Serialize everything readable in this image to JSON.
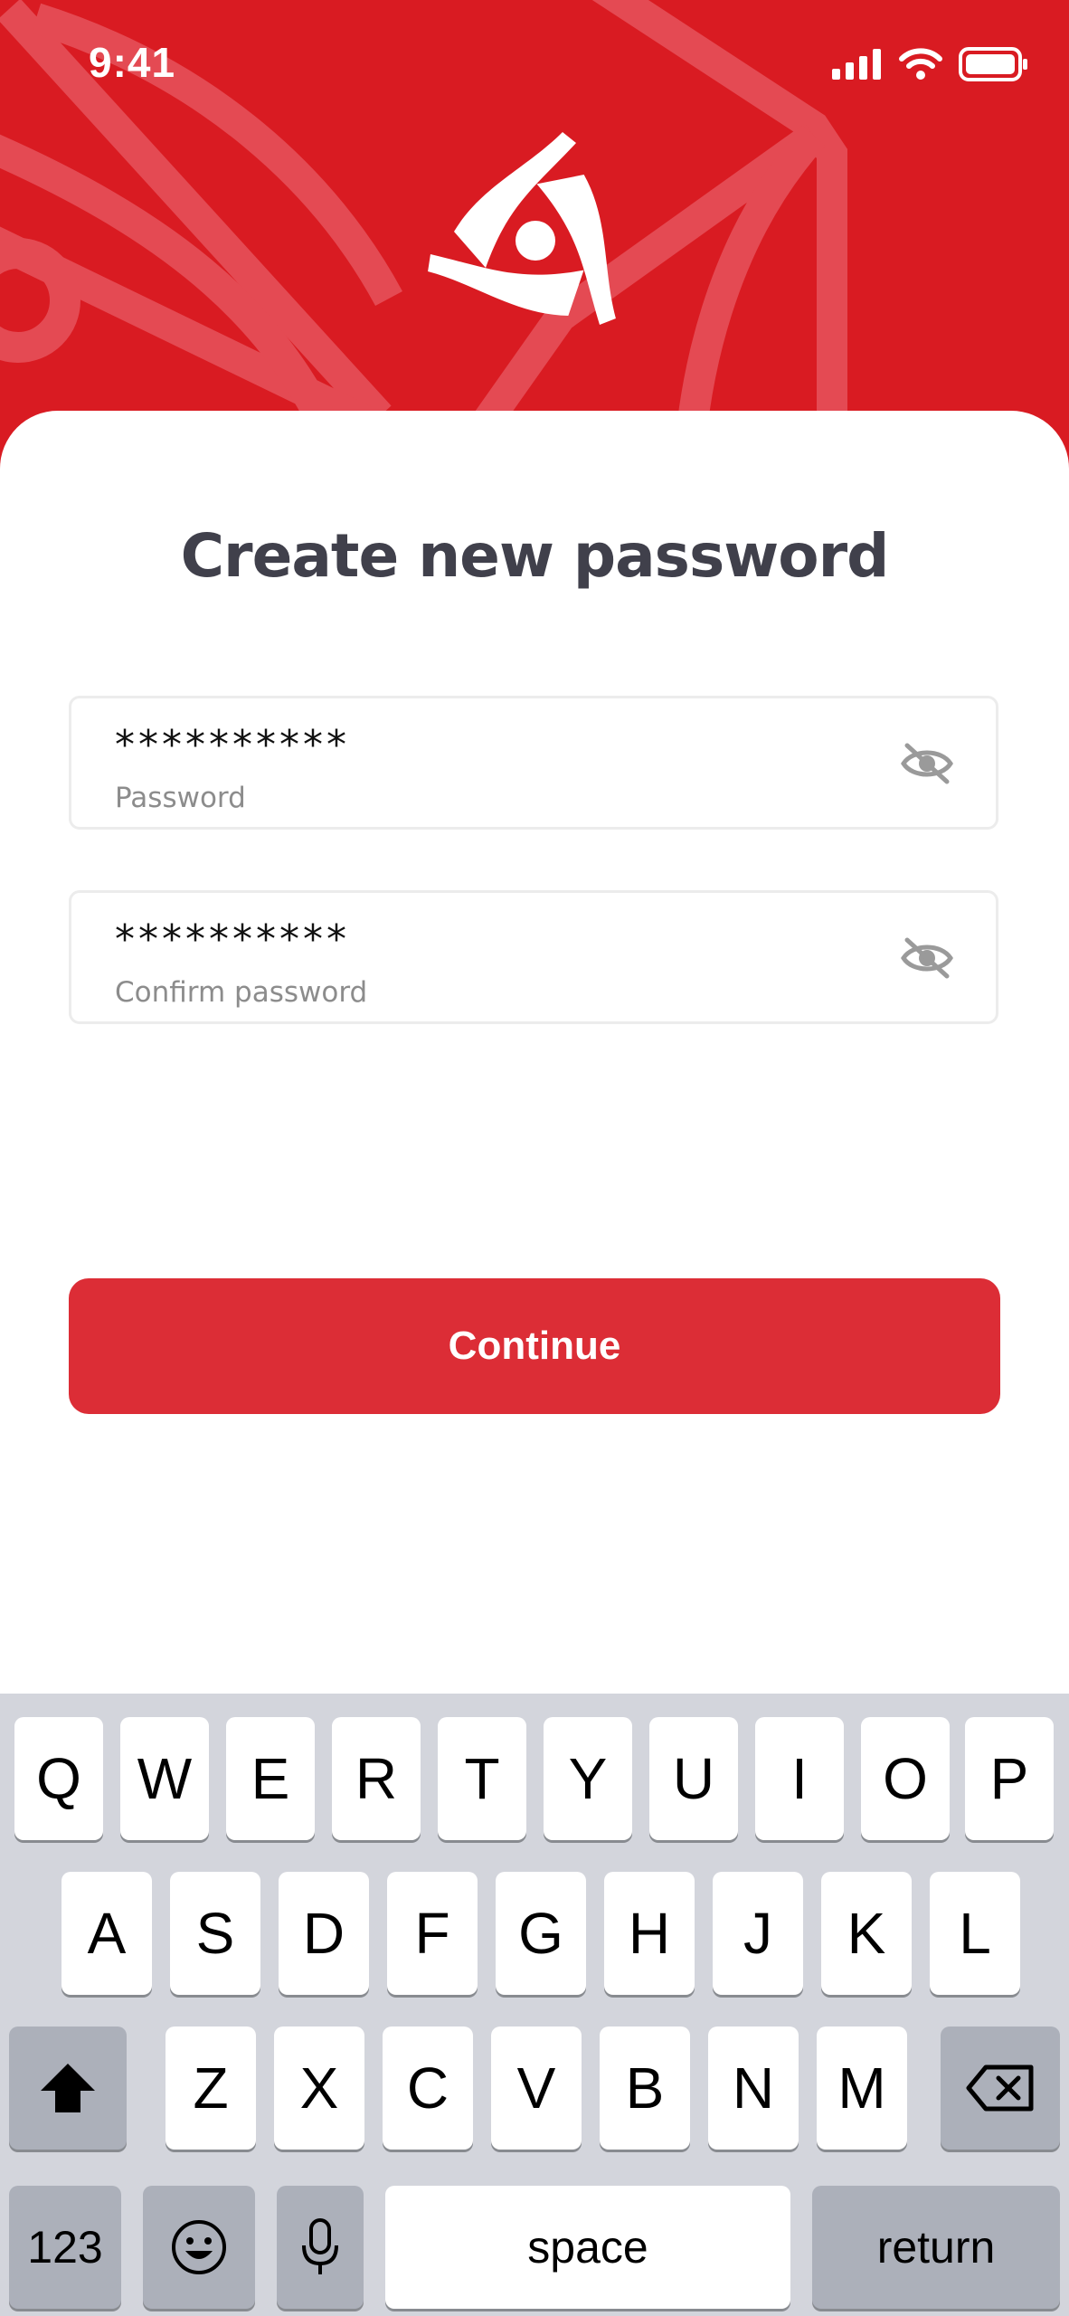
{
  "status_bar": {
    "time": "9:41"
  },
  "header": {
    "logo": "brand-logo",
    "background_color": "#d91b22"
  },
  "form": {
    "title": "Create new password",
    "password": {
      "value": "**********",
      "label": "Password"
    },
    "confirm_password": {
      "value": "**********",
      "label": "Confirm password"
    },
    "continue_label": "Continue"
  },
  "keyboard": {
    "row1": [
      "Q",
      "W",
      "E",
      "R",
      "T",
      "Y",
      "U",
      "I",
      "O",
      "P"
    ],
    "row2": [
      "A",
      "S",
      "D",
      "F",
      "G",
      "H",
      "J",
      "K",
      "L"
    ],
    "row3": [
      "Z",
      "X",
      "C",
      "V",
      "B",
      "N",
      "M"
    ],
    "numbers_label": "123",
    "space_label": "space",
    "return_label": "return"
  },
  "colors": {
    "brand_red": "#d91b22",
    "button_red": "#dc2d36",
    "keyboard_bg": "#d3d5dc"
  }
}
